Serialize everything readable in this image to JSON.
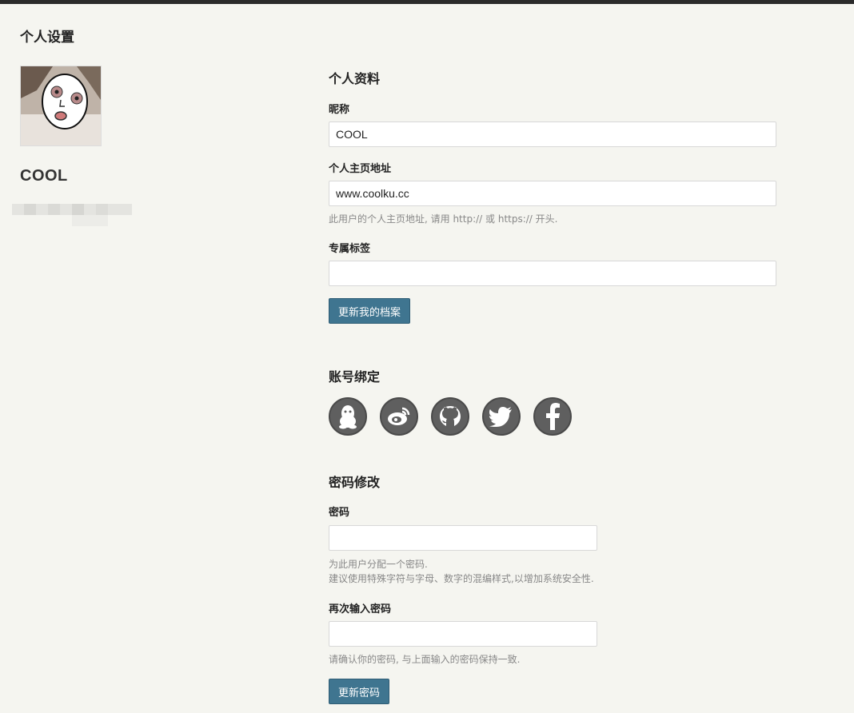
{
  "page": {
    "title": "个人设置"
  },
  "profile_card": {
    "username": "COOL"
  },
  "profile_section": {
    "title": "个人资料",
    "nickname": {
      "label": "昵称",
      "value": "COOL"
    },
    "homepage": {
      "label": "个人主页地址",
      "value": "www.coolku.cc",
      "help": "此用户的个人主页地址, 请用 http:// 或 https:// 开头."
    },
    "tag": {
      "label": "专属标签",
      "value": ""
    },
    "submit_label": "更新我的档案"
  },
  "binding_section": {
    "title": "账号绑定",
    "icons": [
      "qq-icon",
      "weibo-icon",
      "github-icon",
      "twitter-icon",
      "facebook-icon"
    ]
  },
  "password_section": {
    "title": "密码修改",
    "password": {
      "label": "密码",
      "value": "",
      "help_line1": "为此用户分配一个密码.",
      "help_line2": "建议使用特殊字符与字母、数字的混编样式,以增加系统安全性."
    },
    "confirm": {
      "label": "再次输入密码",
      "value": "",
      "help": "请确认你的密码, 与上面输入的密码保持一致."
    },
    "submit_label": "更新密码"
  },
  "colors": {
    "accent": "#3f7590",
    "background": "#f5f5f0",
    "icon": "#5f5f5f"
  }
}
